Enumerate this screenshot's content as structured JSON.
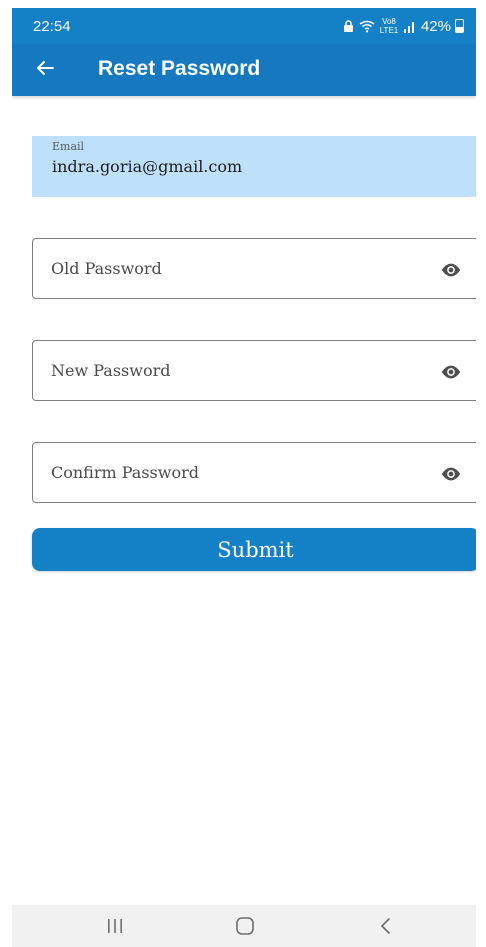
{
  "status_bar": {
    "time": "22:54",
    "network": "Vo8 LTE1",
    "battery": "42%"
  },
  "app_bar": {
    "title": "Reset Password",
    "back_icon": "arrow-left-icon"
  },
  "form": {
    "email": {
      "label": "Email",
      "value": "indra.goria@gmail.com"
    },
    "old_password": {
      "placeholder": "Old Password",
      "icon": "eye-icon"
    },
    "new_password": {
      "placeholder": "New Password",
      "icon": "eye-icon"
    },
    "confirm_password": {
      "placeholder": "Confirm Password",
      "icon": "eye-icon"
    },
    "submit_label": "Submit"
  },
  "nav_bar": {
    "recents_icon": "recents-icon",
    "home_icon": "home-icon",
    "back_icon": "nav-back-icon"
  },
  "colors": {
    "primary": "#1678bf",
    "status_bar": "#1481c6",
    "filled_field": "#bfe0fa",
    "nav_bar": "#f1f1f1"
  }
}
